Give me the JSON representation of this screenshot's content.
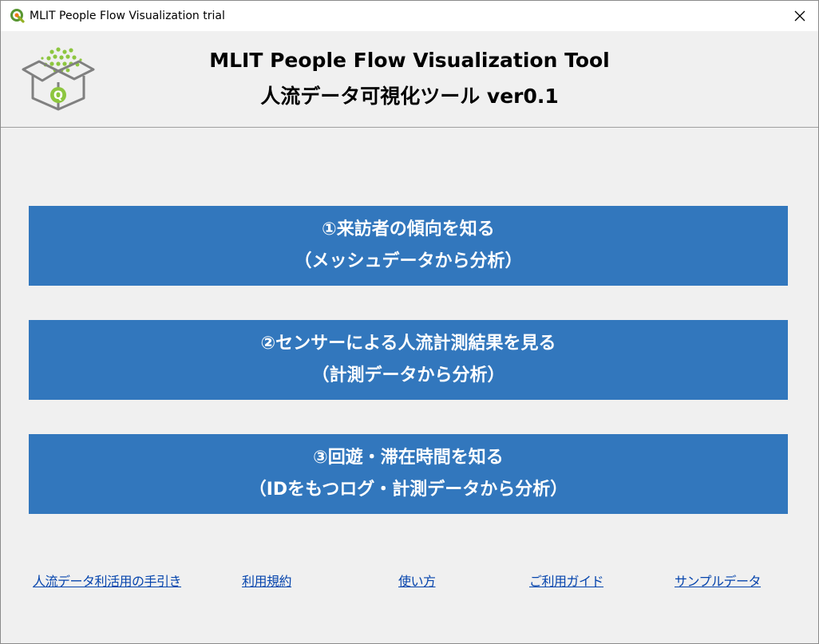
{
  "window": {
    "title": "MLIT People Flow Visualization trial",
    "close_glyph": "✕"
  },
  "header": {
    "title_en": "MLIT People Flow Visualization Tool",
    "title_ja": "人流データ可視化ツール ver0.1",
    "logo_letter": "Q"
  },
  "buttons": [
    {
      "line1": "①来訪者の傾向を知る",
      "line2": "（メッシュデータから分析）"
    },
    {
      "line1": "②センサーによる人流計測結果を見る",
      "line2": "（計測データから分析）"
    },
    {
      "line1": "③回遊・滞在時間を知る",
      "line2": "（IDをもつログ・計測データから分析）"
    }
  ],
  "links": [
    "人流データ利活用の手引き",
    "利用規約",
    "使い方",
    "ご利用ガイド",
    "サンプルデータ"
  ],
  "colors": {
    "button_bg": "#3277bd",
    "link": "#0645ad",
    "logo_green": "#8dc63f",
    "logo_gray": "#808080"
  }
}
